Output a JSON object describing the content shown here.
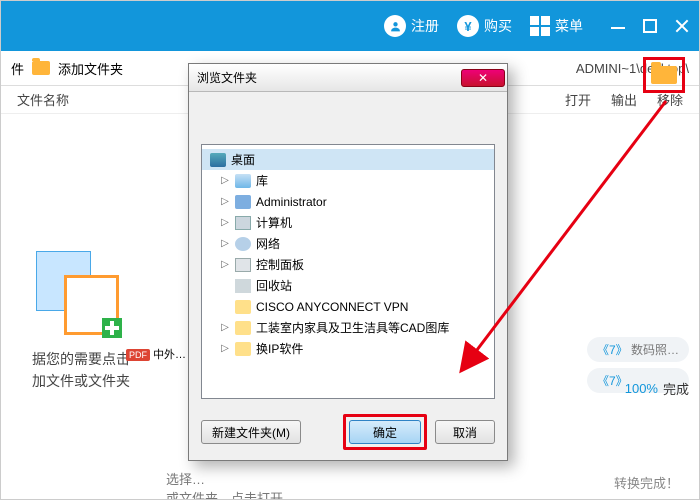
{
  "titlebar": {
    "register": "注册",
    "buy": "购买",
    "menu": "菜单",
    "currency": "¥"
  },
  "toolbar": {
    "file": "件",
    "add_folder": "添加文件夹",
    "path": "ADMINI~1\\desktop\\"
  },
  "columns": {
    "name": "文件名称",
    "open": "打开",
    "export": "输出",
    "remove": "移除"
  },
  "bg": {
    "line1": "据您的需要点击",
    "line2": "加文件或文件夹",
    "pdf": "PDF",
    "pdf_text": "中外…",
    "hint_a": "选择…",
    "hint_b": "或文件夹，点击打开",
    "chip_a_pre": "《7》",
    "chip_a_post": "数码照…",
    "chip_b_pre": "《7》",
    "progress_pct": "100%",
    "progress_text": "完成",
    "done": "转换完成！"
  },
  "dialog": {
    "title": "浏览文件夹",
    "close": "✕",
    "new_folder": "新建文件夹(M)",
    "ok": "确定",
    "cancel": "取消",
    "tree": [
      {
        "label": "桌面",
        "icon": "ic-desktop",
        "exp": "",
        "root": true,
        "sel": true
      },
      {
        "label": "库",
        "icon": "ic-lib",
        "exp": "▷"
      },
      {
        "label": "Administrator",
        "icon": "ic-user",
        "exp": "▷"
      },
      {
        "label": "计算机",
        "icon": "ic-pc",
        "exp": "▷"
      },
      {
        "label": "网络",
        "icon": "ic-net",
        "exp": "▷"
      },
      {
        "label": "控制面板",
        "icon": "ic-cpl",
        "exp": "▷"
      },
      {
        "label": "回收站",
        "icon": "ic-bin",
        "exp": ""
      },
      {
        "label": "CISCO ANYCONNECT VPN",
        "icon": "ic-folder",
        "exp": ""
      },
      {
        "label": "工装室内家具及卫生洁具等CAD图库",
        "icon": "ic-folder",
        "exp": "▷"
      },
      {
        "label": "换IP软件",
        "icon": "ic-folder",
        "exp": "▷"
      }
    ]
  }
}
